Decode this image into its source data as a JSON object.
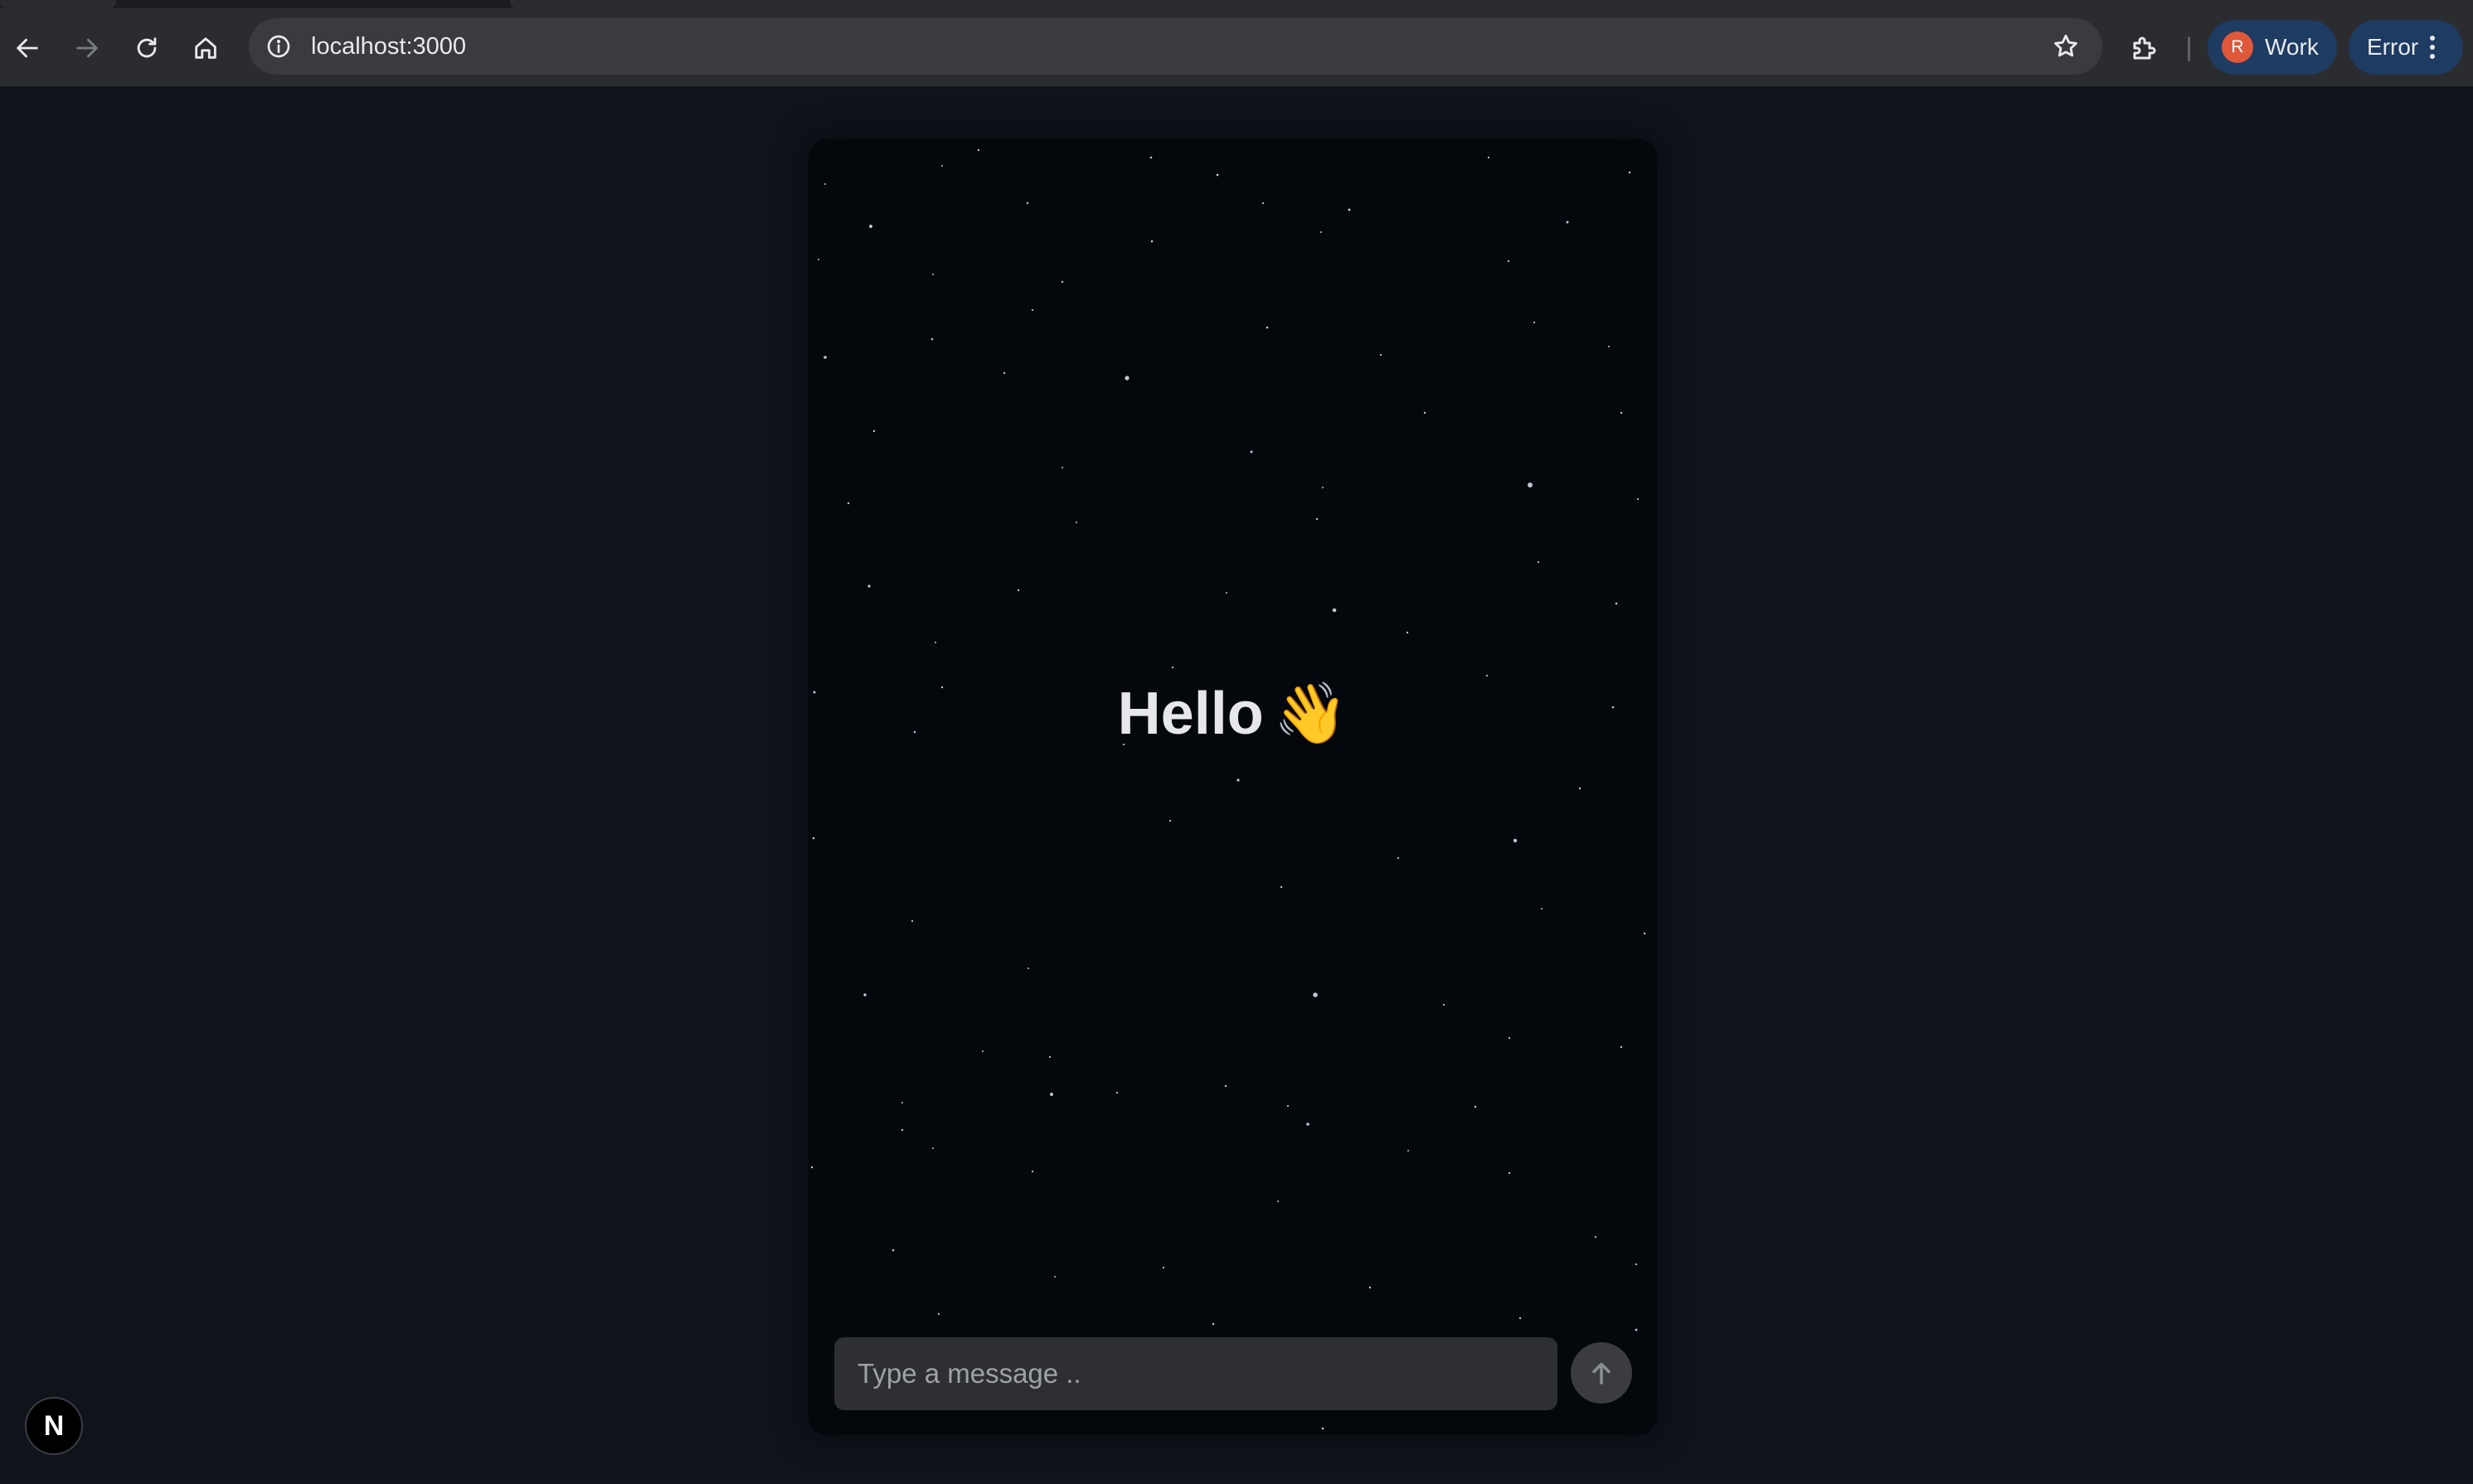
{
  "browser": {
    "url": "localhost:3000",
    "profile": {
      "initial": "R",
      "label": "Work"
    },
    "error_label": "Error",
    "icons": {
      "back": "arrow-left-icon",
      "forward": "arrow-right-icon",
      "reload": "reload-icon",
      "home": "home-icon",
      "site_info": "info-icon",
      "bookmark": "star-icon",
      "extensions": "puzzle-icon",
      "menu": "kebab-menu-icon"
    }
  },
  "chat": {
    "greeting": "Hello",
    "greeting_emoji": "👋",
    "input_placeholder": "Type a message ..",
    "input_value": "",
    "send_icon": "arrow-up-icon"
  },
  "devtools_badge": {
    "letter": "N"
  },
  "colors": {
    "page_bg": "#0f131a",
    "card_bg": "#04070c",
    "input_bg": "#2d2f33",
    "profile_chip_bg": "#1e3b62",
    "avatar_bg": "#e0583a"
  }
}
